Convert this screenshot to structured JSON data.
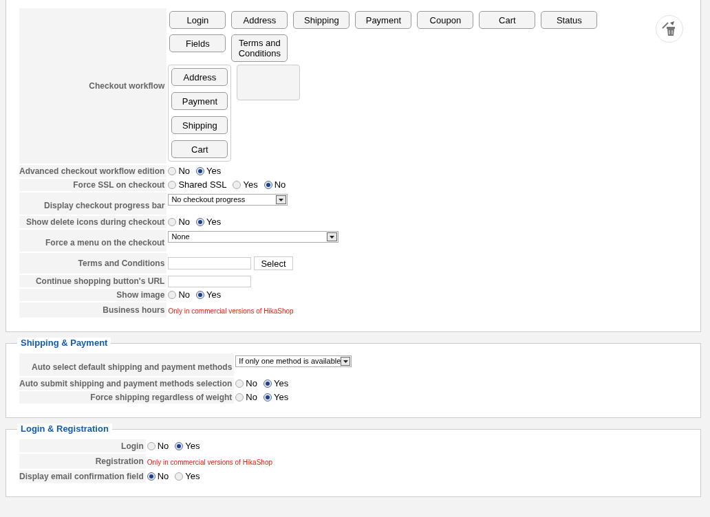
{
  "sections": [
    {
      "rows": [
        {
          "kind": "workflow",
          "label": "Checkout workflow",
          "palette": [
            "Login",
            "Address",
            "Shipping",
            "Payment",
            "Coupon",
            "Cart",
            "Status",
            "Fields",
            "Terms and Conditions"
          ],
          "steps": [
            [
              "Address",
              "Payment",
              "Shipping",
              "Cart"
            ]
          ],
          "empty_drop_zone": true
        },
        {
          "kind": "radio",
          "label": "Advanced checkout workflow edition",
          "options": [
            {
              "label": "No",
              "selected": false
            },
            {
              "label": "Yes",
              "selected": true
            }
          ]
        },
        {
          "kind": "radio",
          "label": "Force SSL on checkout",
          "options": [
            {
              "label": "Shared SSL",
              "selected": false
            },
            {
              "label": "Yes",
              "selected": false
            },
            {
              "label": "No",
              "selected": true
            }
          ]
        },
        {
          "kind": "select",
          "label": "Display checkout progress bar",
          "value": "No checkout progress"
        },
        {
          "kind": "radio",
          "label": "Show delete icons during checkout",
          "options": [
            {
              "label": "No",
              "selected": false
            },
            {
              "label": "Yes",
              "selected": true
            }
          ]
        },
        {
          "kind": "select",
          "label": "Force a menu on the checkout",
          "value": "None"
        },
        {
          "kind": "text_select",
          "label": "Terms and Conditions",
          "button": "Select"
        },
        {
          "kind": "text",
          "label": "Continue shopping button's URL"
        },
        {
          "kind": "radio",
          "label": "Show image",
          "options": [
            {
              "label": "No",
              "selected": false
            },
            {
              "label": "Yes",
              "selected": true
            }
          ]
        },
        {
          "kind": "notice",
          "label": "Business hours",
          "text": "Only in commercial versions of HikaShop"
        }
      ]
    },
    {
      "legend": "Shipping & Payment",
      "rows": [
        {
          "kind": "select",
          "label": "Auto select default shipping and payment methods",
          "value": "If only one method is available"
        },
        {
          "kind": "radio",
          "label": "Auto submit shipping and payment methods selection",
          "options": [
            {
              "label": "No",
              "selected": false
            },
            {
              "label": "Yes",
              "selected": true
            }
          ]
        },
        {
          "kind": "radio",
          "label": "Force shipping regardless of weight",
          "options": [
            {
              "label": "No",
              "selected": false
            },
            {
              "label": "Yes",
              "selected": true
            }
          ]
        }
      ]
    },
    {
      "legend": "Login & Registration",
      "rows": [
        {
          "kind": "radio",
          "label": "Login",
          "options": [
            {
              "label": "No",
              "selected": false
            },
            {
              "label": "Yes",
              "selected": true
            }
          ]
        },
        {
          "kind": "notice",
          "label": "Registration",
          "text": "Only in commercial versions of HikaShop"
        },
        {
          "kind": "radio",
          "label": "Display email confirmation field",
          "options": [
            {
              "label": "No",
              "selected": true
            },
            {
              "label": "Yes",
              "selected": false
            }
          ]
        }
      ]
    }
  ]
}
